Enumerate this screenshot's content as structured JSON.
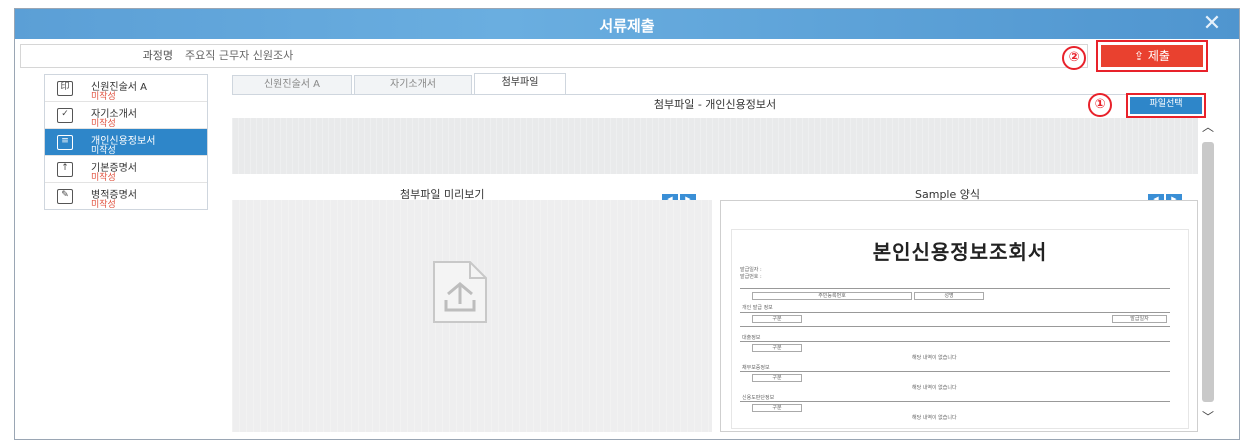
{
  "window": {
    "title": "서류제출",
    "close_icon": "close-icon"
  },
  "course": {
    "label": "과정명",
    "value": "주요직 근무자 신원조사"
  },
  "submit": {
    "label": "제출",
    "icon": "upload-icon",
    "color": "#e9412f"
  },
  "badges": {
    "one": "①",
    "two": "②"
  },
  "sidebar": {
    "items": [
      {
        "name": "신원진술서 A",
        "status": "미작성",
        "icon": "seal-icon",
        "glyph": "印"
      },
      {
        "name": "자기소개서",
        "status": "미작성",
        "icon": "checkbox-icon",
        "glyph": "✓"
      },
      {
        "name": "개인신용정보서",
        "status": "미작성",
        "icon": "document-icon",
        "glyph": "≡"
      },
      {
        "name": "기본증명서",
        "status": "미작성",
        "icon": "upload-box-icon",
        "glyph": "↑"
      },
      {
        "name": "병적증명서",
        "status": "미작성",
        "icon": "edit-icon",
        "glyph": "✎"
      }
    ],
    "active_color": "#2e86c9"
  },
  "tabs": [
    {
      "label": "신원진술서 A"
    },
    {
      "label": "자기소개서"
    },
    {
      "label": "첨부파일"
    }
  ],
  "document": {
    "title": "첨부파일 - 개인신용정보서"
  },
  "file_select": {
    "label": "파일선택"
  },
  "preview": {
    "heading": "첨부파일 미리보기",
    "icon": "file-upload-icon"
  },
  "sample": {
    "heading": "Sample 양식",
    "doc_title": "본인신용정보조회서",
    "lines": [
      "발급일자 :",
      "발급번호 :",
      "개인 발급 정보",
      "대출정보",
      "채무보증정보",
      "신용도판단정보",
      "주민등록번호",
      "성명",
      "구분",
      "발급일자",
      "해당 내역이 없습니다"
    ]
  },
  "nav": {
    "prev": "◀",
    "next": "▶"
  }
}
